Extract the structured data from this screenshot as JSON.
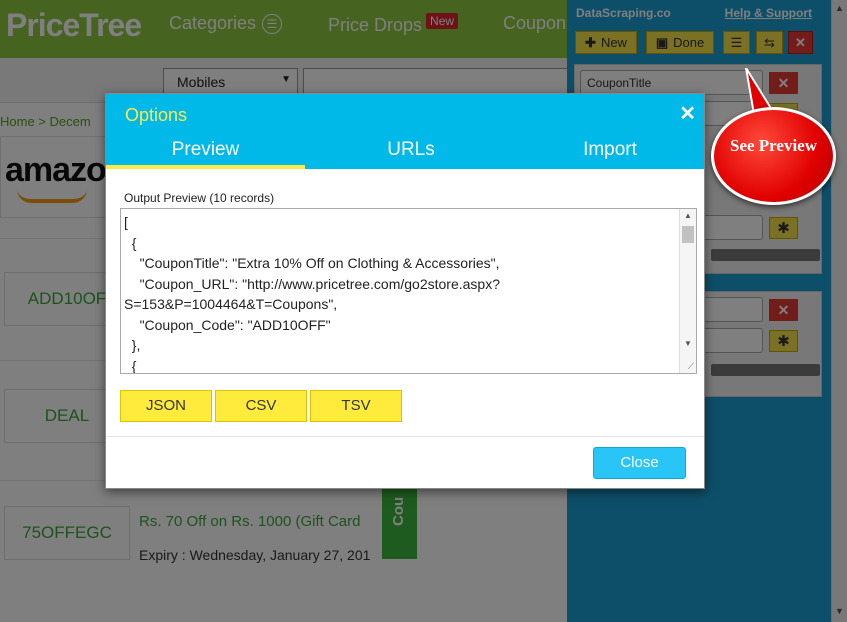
{
  "site": {
    "logo": "PriceTree",
    "nav_categories": "Categories",
    "nav_price_drops": "Price Drops",
    "nav_new_badge": "New",
    "nav_coupons": "Coupon",
    "category_select": "Mobiles",
    "breadcrumb": "Home > Decem",
    "store_logo": "amazon",
    "coupons": [
      {
        "code": "ADD10OF",
        "title": "",
        "expiry": ""
      },
      {
        "code": "DEAL",
        "title": "",
        "expiry": ""
      },
      {
        "code": "75OFFEGC",
        "title": "Rs. 70 Off on Rs. 1000 (Gift Card",
        "expiry": "Expiry : Wednesday, January 27, 201"
      }
    ],
    "strip_label": "Cou"
  },
  "panel": {
    "brand": "DataScraping.co",
    "help": "Help & Support",
    "new_label": "New",
    "done_label": "Done",
    "field_value": "CouponTitle",
    "callout": "See Preview"
  },
  "modal": {
    "title": "Options",
    "tabs": [
      "Preview",
      "URLs",
      "Import"
    ],
    "output_label": "Output Preview (10 records)",
    "preview_text": "[\n  {\n    \"CouponTitle\": \"Extra 10% Off on Clothing & Accessories\",\n    \"Coupon_URL\": \"http://www.pricetree.com/go2store.aspx?\nS=153&P=1004464&T=Coupons\",\n    \"Coupon_Code\": \"ADD10OFF\"\n  },\n  {",
    "formats": [
      "JSON",
      "CSV",
      "TSV"
    ],
    "close_label": "Close"
  }
}
